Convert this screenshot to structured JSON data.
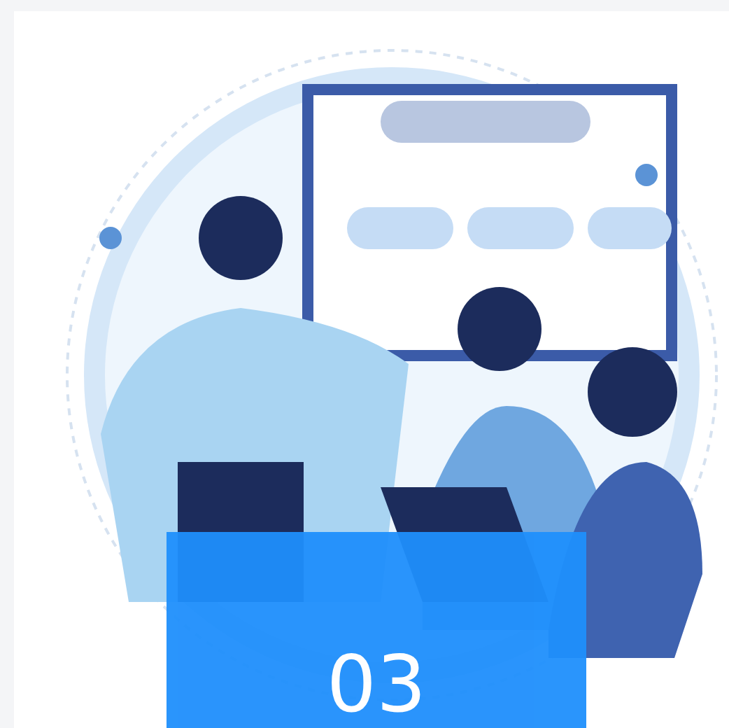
{
  "card": {
    "number_banner": {
      "text": "03"
    }
  }
}
